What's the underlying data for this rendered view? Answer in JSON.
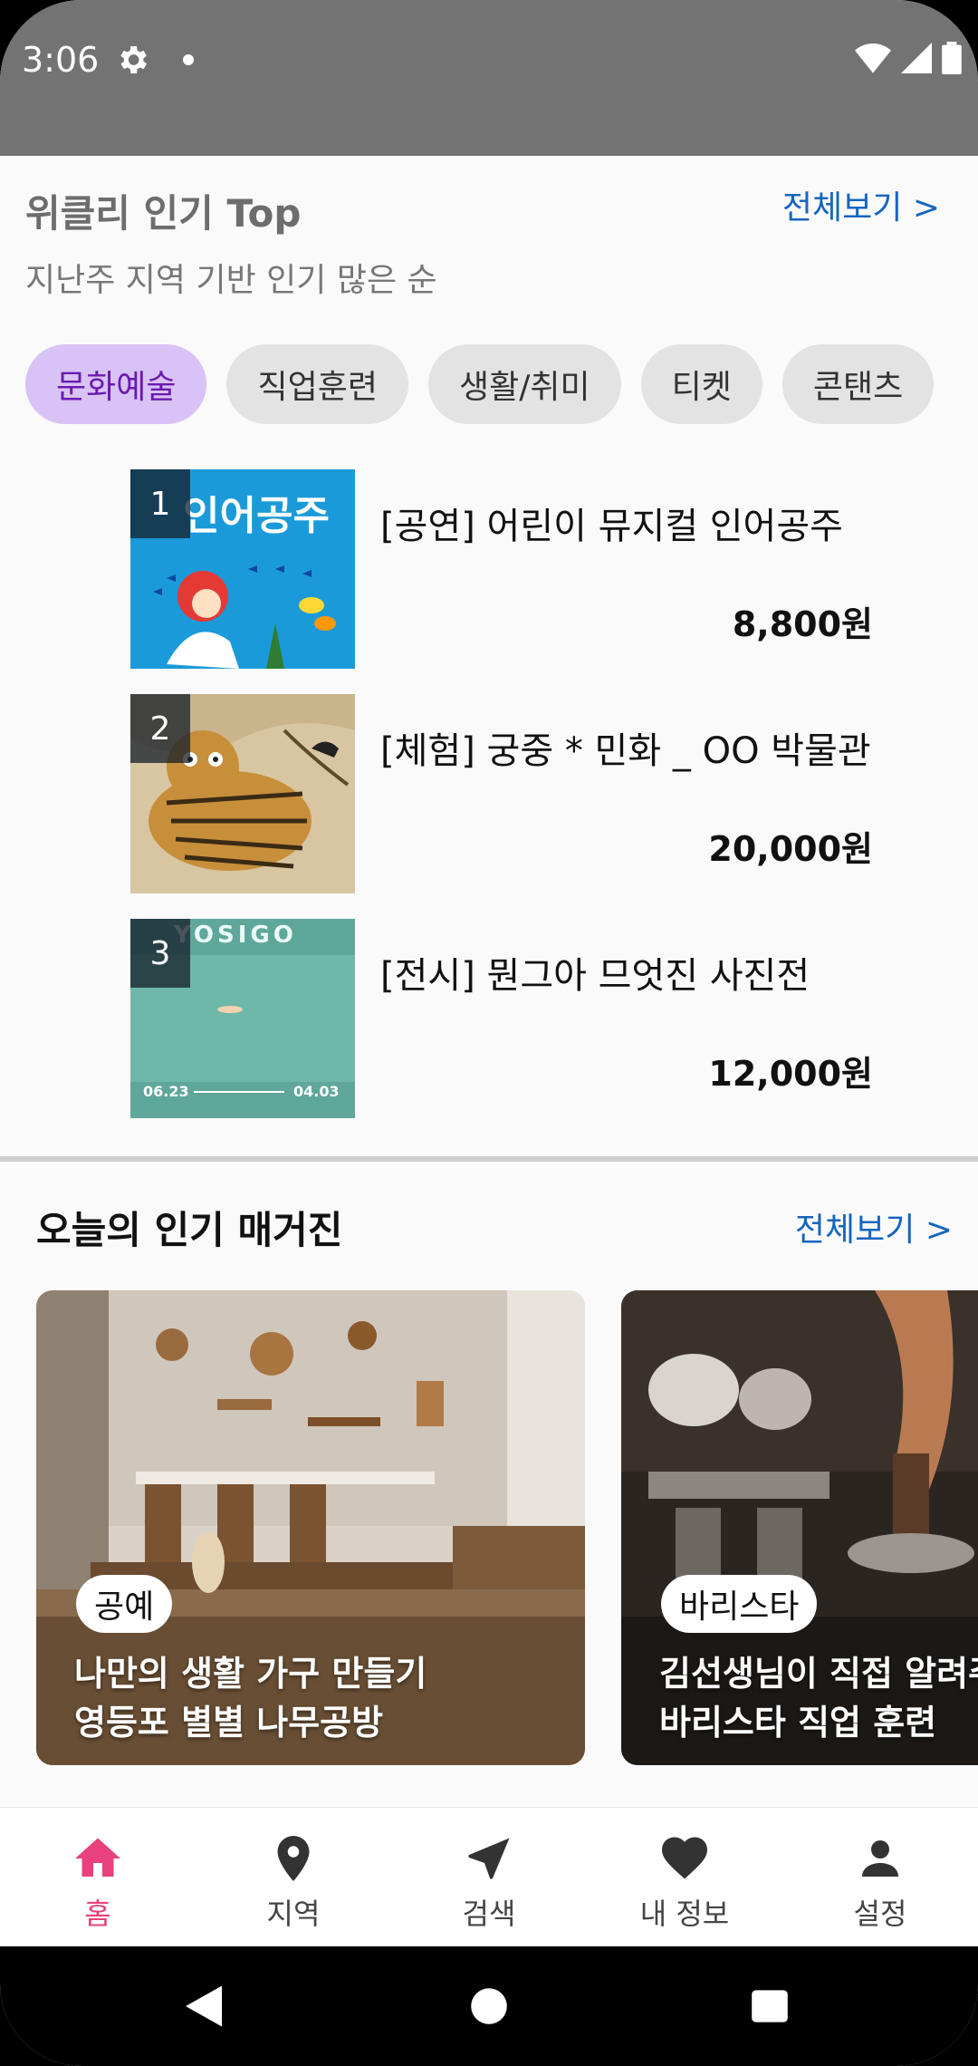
{
  "status": {
    "time": "3:06"
  },
  "weekly": {
    "title": "위클리 인기 Top",
    "see_all": "전체보기 >",
    "subtitle": "지난주 지역 기반 인기 많은 순",
    "chips": [
      "문화예술",
      "직업훈련",
      "생활/취미",
      "티켓",
      "콘탠츠"
    ],
    "active_chip": "문화예술",
    "items": [
      {
        "rank": "1",
        "title": "[공연] 어린이 뮤지컬 인어공주",
        "price": "8,800원",
        "thumb_text": "인어공주"
      },
      {
        "rank": "2",
        "title": "[체험] 궁중 * 민화 _ OO 박물관",
        "price": "20,000원"
      },
      {
        "rank": "3",
        "title": "[전시] 뭔그아 므엇진 사진전",
        "price": "12,000원",
        "thumb_text": "YOSIGO",
        "thumb_dates": [
          "06.23",
          "04.03"
        ]
      }
    ]
  },
  "magazine": {
    "title": "오늘의 인기 매거진",
    "see_all": "전체보기 >",
    "cards": [
      {
        "badge": "공예",
        "line1": "나만의 생활 가구 만들기",
        "line2": "영등포 별별 나무공방"
      },
      {
        "badge": "바리스타",
        "line1": "김선생님이 직접 알려주",
        "line2": "바리스타 직업 훈련"
      }
    ]
  },
  "nav": {
    "items": [
      {
        "label": "홈",
        "icon": "home-icon"
      },
      {
        "label": "지역",
        "icon": "location-pin-icon"
      },
      {
        "label": "검색",
        "icon": "navigation-arrow-icon"
      },
      {
        "label": "내 정보",
        "icon": "heart-icon"
      },
      {
        "label": "설정",
        "icon": "person-icon"
      }
    ],
    "active": "홈"
  },
  "colors": {
    "accent_pink": "#e8417b",
    "link_blue": "#1565c0",
    "chip_active_bg": "#d9c2f5",
    "chip_active_text": "#6a1bb0"
  }
}
